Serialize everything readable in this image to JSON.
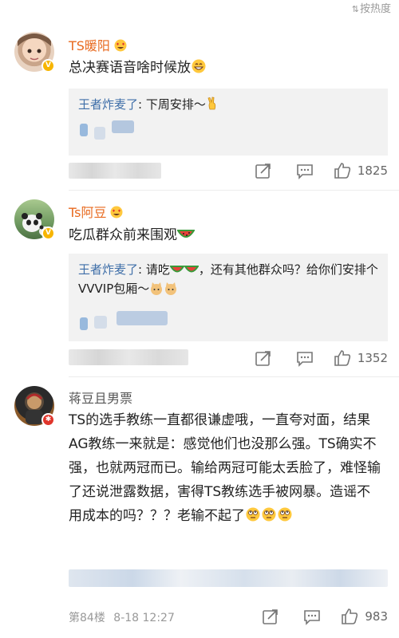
{
  "header": {
    "sort_icon": "sort-icon",
    "sort_label": "按热度"
  },
  "comments": [
    {
      "username": "TS暖阳",
      "text": "总决赛语音啥时候放",
      "reply_author": "王者炸麦了",
      "reply_text": ": 下周安排～",
      "likes": "1825",
      "icons": [
        "share-icon",
        "comment-icon",
        "like-icon"
      ]
    },
    {
      "username": "Ts阿豆",
      "text": "吃瓜群众前来围观",
      "reply_author": "王者炸麦了",
      "reply_text": ": 请吃",
      "reply_text_2": "，还有其他群众吗？给你们安排个VVVIP包厢～",
      "likes": "1352",
      "icons": [
        "share-icon",
        "comment-icon",
        "like-icon"
      ]
    },
    {
      "username": "蒋豆且男票",
      "text": "TS的选手教练一直都很谦虚哦，一直夸对面，结果AG教练一来就是：感觉他们也没那么强。TS确实不强，也就两冠而已。输给两冠可能太丢脸了，难怪输了还说泄露数据，害得TS教练选手被网暴。造谣不用成本的吗？？？老输不起了",
      "floor": "第84楼",
      "date": "8-18 12:27",
      "likes": "983",
      "icons": [
        "share-icon",
        "comment-icon",
        "like-icon"
      ]
    }
  ],
  "colors": {
    "username": "#e86a1f",
    "reply_name": "#3e6ea8",
    "reply_bg": "#f2f2f2",
    "muted": "#999999"
  }
}
